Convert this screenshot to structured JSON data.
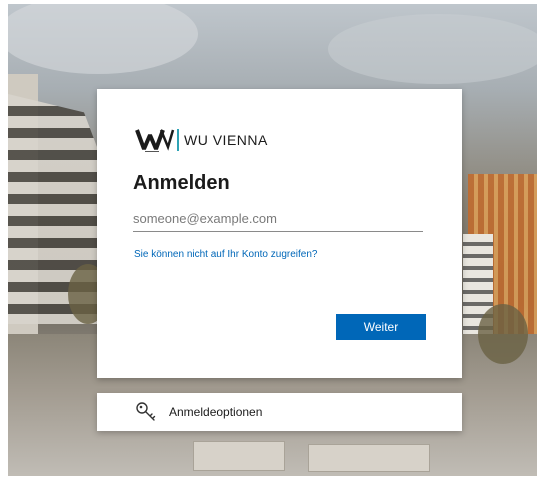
{
  "brand": {
    "logo_name": "WU VIENNA",
    "accent_color": "#2ea3b5"
  },
  "signin": {
    "title": "Anmelden",
    "email_placeholder": "someone@example.com",
    "email_value": "",
    "help_link": "Sie können nicht auf Ihr Konto zugreifen?",
    "next_button": "Weiter",
    "button_color": "#0067b8",
    "link_color": "#0067b8"
  },
  "options": {
    "label": "Anmeldeoptionen",
    "icon": "key-icon"
  }
}
